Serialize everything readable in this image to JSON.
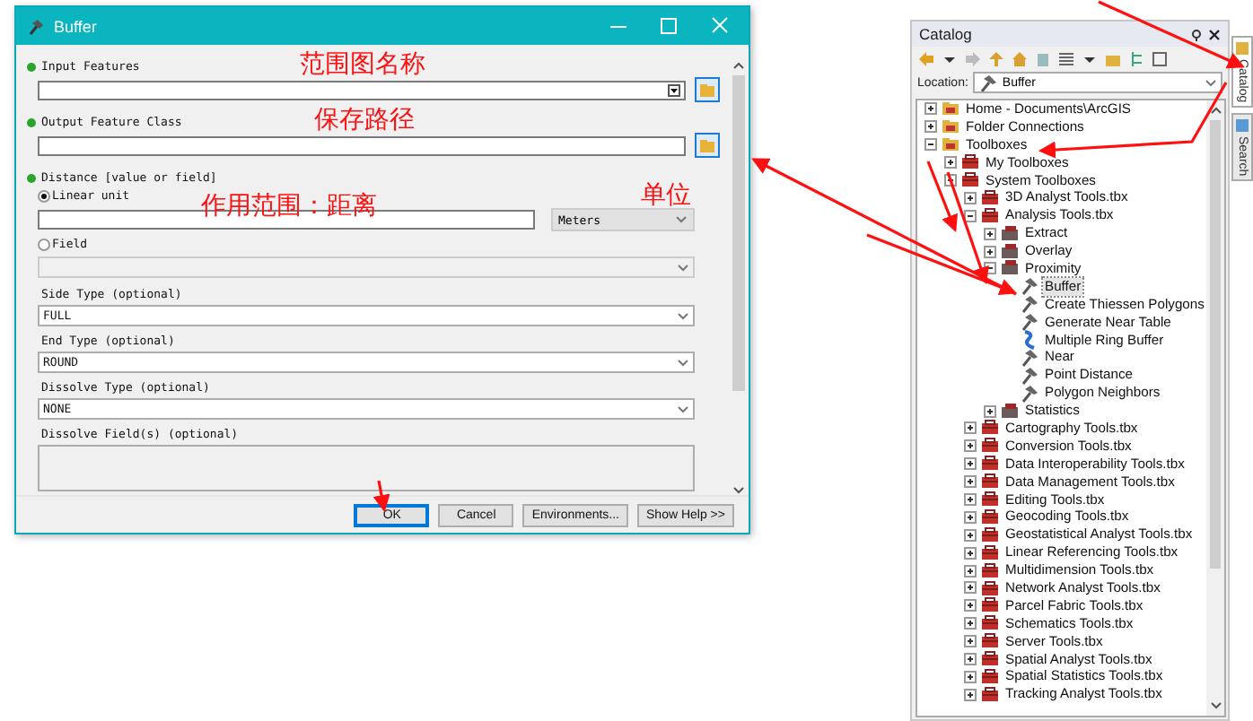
{
  "dialog": {
    "title": "Buffer",
    "params": [
      {
        "kind": "layer",
        "label": "Input Features",
        "required": true
      },
      {
        "kind": "output",
        "label": "Output Feature Class",
        "required": true
      },
      {
        "kind": "distance",
        "label": "Distance [value or field]",
        "required": true,
        "options": [
          {
            "label": "Linear unit",
            "selected": true
          },
          {
            "label": "Field",
            "selected": false
          }
        ],
        "unit": "Meters"
      },
      {
        "kind": "select",
        "label": "Side Type (optional)",
        "required": false,
        "value": "FULL"
      },
      {
        "kind": "select",
        "label": "End Type (optional)",
        "required": false,
        "value": "ROUND"
      },
      {
        "kind": "select",
        "label": "Dissolve Type (optional)",
        "required": false,
        "value": "NONE"
      },
      {
        "kind": "list",
        "label": "Dissolve Field(s) (optional)",
        "required": false
      }
    ],
    "buttons": [
      {
        "label": "OK",
        "focused": true
      },
      {
        "label": "Cancel",
        "focused": false
      },
      {
        "label": "Environments...",
        "focused": false
      },
      {
        "label": "Show Help >>",
        "focused": false
      }
    ]
  },
  "annotations": [
    {
      "text": "范围图名称"
    },
    {
      "text": "保存路径"
    },
    {
      "text": "作用范围：距离"
    },
    {
      "text": "单位"
    }
  ],
  "catalog": {
    "title": "Catalog",
    "location_label": "Location:",
    "location": "Buffer",
    "tree": [
      {
        "label": "Home - Documents\\ArcGIS",
        "kind": "folder",
        "expanded": false,
        "selected": false
      },
      {
        "label": "Folder Connections",
        "kind": "folder",
        "expanded": false,
        "selected": false
      },
      {
        "label": "Toolboxes",
        "kind": "folder",
        "expanded": true,
        "selected": false,
        "children": [
          {
            "label": "My Toolboxes",
            "kind": "toolbox",
            "expanded": false,
            "selected": false
          },
          {
            "label": "System Toolboxes",
            "kind": "toolbox",
            "expanded": true,
            "selected": false,
            "children": [
              {
                "label": "3D Analyst Tools.tbx",
                "kind": "toolbox",
                "expanded": false,
                "selected": false
              },
              {
                "label": "Analysis Tools.tbx",
                "kind": "toolbox",
                "expanded": true,
                "selected": false,
                "children": [
                  {
                    "label": "Extract",
                    "kind": "toolset",
                    "expanded": false,
                    "selected": false
                  },
                  {
                    "label": "Overlay",
                    "kind": "toolset",
                    "expanded": false,
                    "selected": false
                  },
                  {
                    "label": "Proximity",
                    "kind": "toolset",
                    "expanded": true,
                    "selected": false,
                    "children": [
                      {
                        "label": "Buffer",
                        "kind": "tool",
                        "selected": true
                      },
                      {
                        "label": "Create Thiessen Polygons",
                        "kind": "tool",
                        "selected": false
                      },
                      {
                        "label": "Generate Near Table",
                        "kind": "tool",
                        "selected": false
                      },
                      {
                        "label": "Multiple Ring Buffer",
                        "kind": "model",
                        "selected": false
                      },
                      {
                        "label": "Near",
                        "kind": "tool",
                        "selected": false
                      },
                      {
                        "label": "Point Distance",
                        "kind": "tool",
                        "selected": false
                      },
                      {
                        "label": "Polygon Neighbors",
                        "kind": "tool",
                        "selected": false
                      }
                    ]
                  },
                  {
                    "label": "Statistics",
                    "kind": "toolset",
                    "expanded": false,
                    "selected": false
                  }
                ]
              },
              {
                "label": "Cartography Tools.tbx",
                "kind": "toolbox",
                "expanded": false,
                "selected": false
              },
              {
                "label": "Conversion Tools.tbx",
                "kind": "toolbox",
                "expanded": false,
                "selected": false
              },
              {
                "label": "Data Interoperability Tools.tbx",
                "kind": "toolbox",
                "expanded": false,
                "selected": false
              },
              {
                "label": "Data Management Tools.tbx",
                "kind": "toolbox",
                "expanded": false,
                "selected": false
              },
              {
                "label": "Editing Tools.tbx",
                "kind": "toolbox",
                "expanded": false,
                "selected": false
              },
              {
                "label": "Geocoding Tools.tbx",
                "kind": "toolbox",
                "expanded": false,
                "selected": false
              },
              {
                "label": "Geostatistical Analyst Tools.tbx",
                "kind": "toolbox",
                "expanded": false,
                "selected": false
              },
              {
                "label": "Linear Referencing Tools.tbx",
                "kind": "toolbox",
                "expanded": false,
                "selected": false
              },
              {
                "label": "Multidimension Tools.tbx",
                "kind": "toolbox",
                "expanded": false,
                "selected": false
              },
              {
                "label": "Network Analyst Tools.tbx",
                "kind": "toolbox",
                "expanded": false,
                "selected": false
              },
              {
                "label": "Parcel Fabric Tools.tbx",
                "kind": "toolbox",
                "expanded": false,
                "selected": false
              },
              {
                "label": "Schematics Tools.tbx",
                "kind": "toolbox",
                "expanded": false,
                "selected": false
              },
              {
                "label": "Server Tools.tbx",
                "kind": "toolbox",
                "expanded": false,
                "selected": false
              },
              {
                "label": "Spatial Analyst Tools.tbx",
                "kind": "toolbox",
                "expanded": false,
                "selected": false
              },
              {
                "label": "Spatial Statistics Tools.tbx",
                "kind": "toolbox",
                "expanded": false,
                "selected": false
              },
              {
                "label": "Tracking Analyst Tools.tbx",
                "kind": "toolbox",
                "expanded": false,
                "selected": false
              }
            ]
          }
        ]
      }
    ]
  },
  "side_tabs": [
    {
      "label": "Catalog",
      "selected": true
    },
    {
      "label": "Search",
      "selected": false
    }
  ]
}
